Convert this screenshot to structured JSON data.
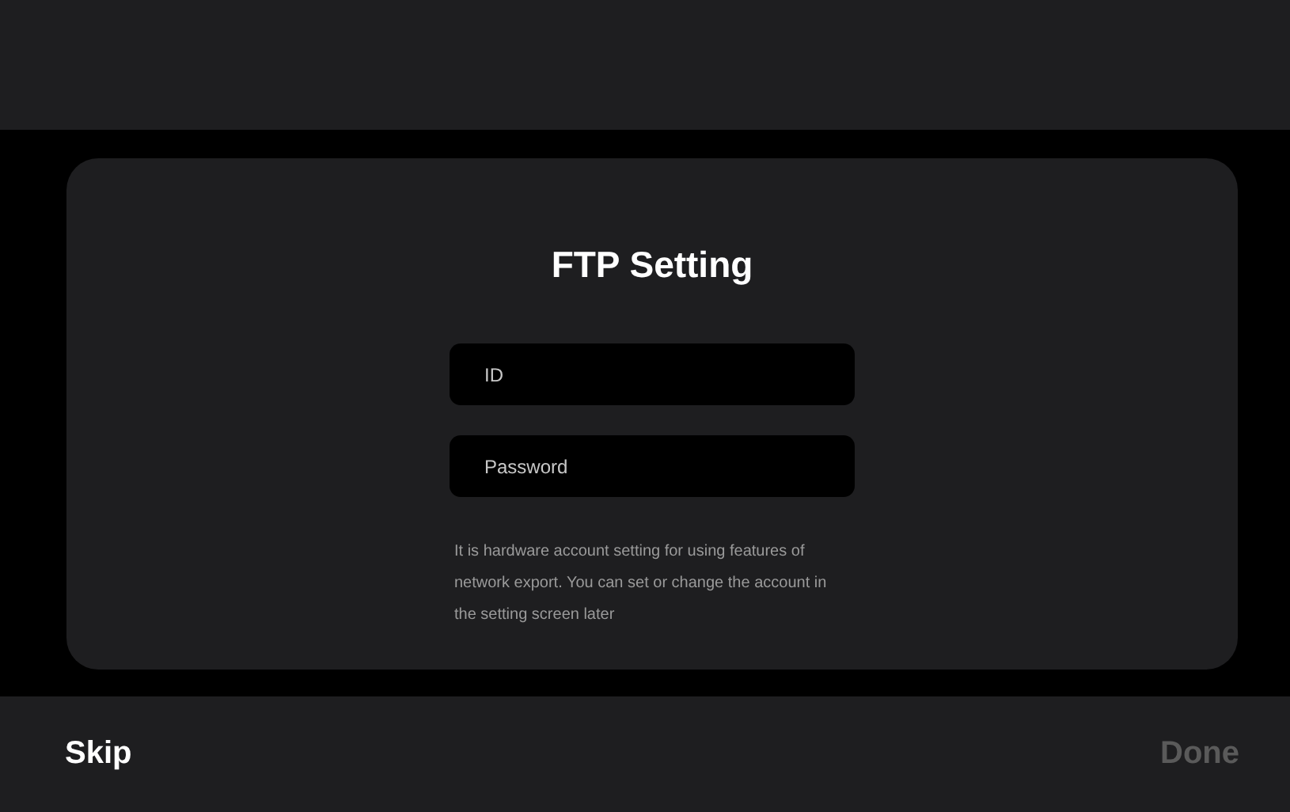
{
  "dialog": {
    "title": "FTP Setting",
    "fields": [
      {
        "placeholder": "ID"
      },
      {
        "placeholder": "Password"
      }
    ],
    "hint": "It is hardware account setting for using features of network export. You can set or change the account in the setting screen later"
  },
  "footer": {
    "buttons": [
      {
        "label": "Skip",
        "disabled": false
      },
      {
        "label": "Done",
        "disabled": true
      }
    ]
  }
}
